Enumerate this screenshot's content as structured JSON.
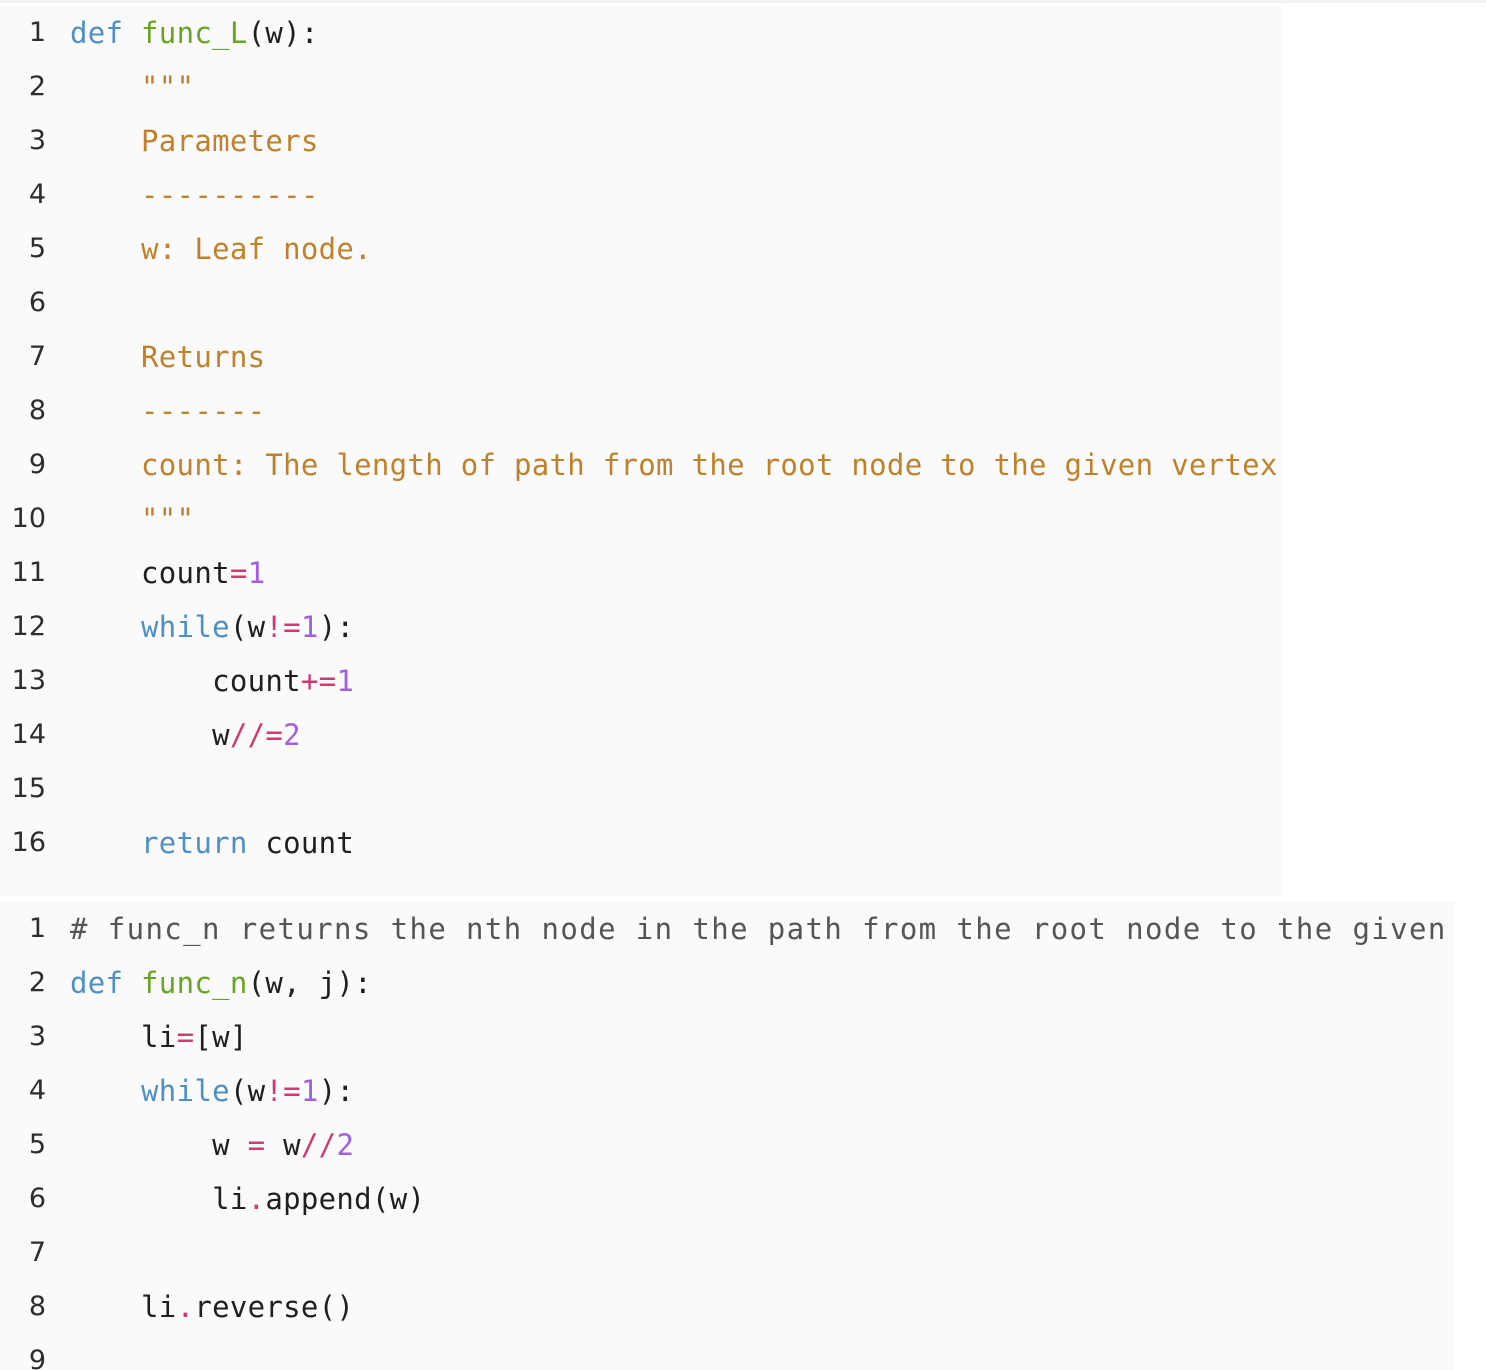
{
  "colors": {
    "keyword": "#4f8fc4",
    "function": "#6aa521",
    "docstring": "#c0812c",
    "operator": "#d13a70",
    "number": "#a45fe0",
    "plain": "#1f1f1f",
    "comment": "#555555",
    "punct": "#1f1f1f"
  },
  "blocks": [
    {
      "name": "code-block-func-L",
      "lines": [
        {
          "num": "1",
          "tokens": [
            {
              "t": "def",
              "c": "keyword"
            },
            {
              "t": " ",
              "c": "plain"
            },
            {
              "t": "func_L",
              "c": "function"
            },
            {
              "t": "(w):",
              "c": "punct"
            }
          ]
        },
        {
          "num": "2",
          "tokens": [
            {
              "t": "    \"\"\"",
              "c": "docstring"
            }
          ]
        },
        {
          "num": "3",
          "tokens": [
            {
              "t": "    Parameters",
              "c": "docstring"
            }
          ]
        },
        {
          "num": "4",
          "tokens": [
            {
              "t": "    ----------",
              "c": "docstring"
            }
          ]
        },
        {
          "num": "5",
          "tokens": [
            {
              "t": "    w: Leaf node.",
              "c": "docstring"
            }
          ]
        },
        {
          "num": "6",
          "tokens": []
        },
        {
          "num": "7",
          "tokens": [
            {
              "t": "    Returns",
              "c": "docstring"
            }
          ]
        },
        {
          "num": "8",
          "tokens": [
            {
              "t": "    -------",
              "c": "docstring"
            }
          ]
        },
        {
          "num": "9",
          "tokens": [
            {
              "t": "    count: The length of path from the root node to the given vertex.",
              "c": "docstring"
            }
          ]
        },
        {
          "num": "10",
          "tokens": [
            {
              "t": "    \"\"\"",
              "c": "docstring"
            }
          ]
        },
        {
          "num": "11",
          "tokens": [
            {
              "t": "    count",
              "c": "plain"
            },
            {
              "t": "=",
              "c": "operator"
            },
            {
              "t": "1",
              "c": "number"
            }
          ]
        },
        {
          "num": "12",
          "tokens": [
            {
              "t": "    ",
              "c": "plain"
            },
            {
              "t": "while",
              "c": "keyword"
            },
            {
              "t": "(w",
              "c": "punct"
            },
            {
              "t": "!=",
              "c": "operator"
            },
            {
              "t": "1",
              "c": "number"
            },
            {
              "t": "):",
              "c": "punct"
            }
          ]
        },
        {
          "num": "13",
          "tokens": [
            {
              "t": "        count",
              "c": "plain"
            },
            {
              "t": "+=",
              "c": "operator"
            },
            {
              "t": "1",
              "c": "number"
            }
          ]
        },
        {
          "num": "14",
          "tokens": [
            {
              "t": "        w",
              "c": "plain"
            },
            {
              "t": "//=",
              "c": "operator"
            },
            {
              "t": "2",
              "c": "number"
            }
          ]
        },
        {
          "num": "15",
          "tokens": []
        },
        {
          "num": "16",
          "tokens": [
            {
              "t": "    ",
              "c": "plain"
            },
            {
              "t": "return",
              "c": "keyword"
            },
            {
              "t": " count",
              "c": "plain"
            }
          ]
        }
      ]
    },
    {
      "name": "code-block-func-n",
      "lines": [
        {
          "num": "1",
          "tokens": [
            {
              "t": "# func_n returns the nth node in the path from the root node to the given vertex",
              "c": "comment"
            }
          ]
        },
        {
          "num": "2",
          "tokens": [
            {
              "t": "def",
              "c": "keyword"
            },
            {
              "t": " ",
              "c": "plain"
            },
            {
              "t": "func_n",
              "c": "function"
            },
            {
              "t": "(w, j):",
              "c": "punct"
            }
          ]
        },
        {
          "num": "3",
          "tokens": [
            {
              "t": "    li",
              "c": "plain"
            },
            {
              "t": "=",
              "c": "operator"
            },
            {
              "t": "[w]",
              "c": "punct"
            }
          ]
        },
        {
          "num": "4",
          "tokens": [
            {
              "t": "    ",
              "c": "plain"
            },
            {
              "t": "while",
              "c": "keyword"
            },
            {
              "t": "(w",
              "c": "punct"
            },
            {
              "t": "!=",
              "c": "operator"
            },
            {
              "t": "1",
              "c": "number"
            },
            {
              "t": "):",
              "c": "punct"
            }
          ]
        },
        {
          "num": "5",
          "tokens": [
            {
              "t": "        w ",
              "c": "plain"
            },
            {
              "t": "=",
              "c": "operator"
            },
            {
              "t": " w",
              "c": "plain"
            },
            {
              "t": "//",
              "c": "operator"
            },
            {
              "t": "2",
              "c": "number"
            }
          ]
        },
        {
          "num": "6",
          "tokens": [
            {
              "t": "        li",
              "c": "plain"
            },
            {
              "t": ".",
              "c": "operator"
            },
            {
              "t": "append(w)",
              "c": "plain"
            }
          ]
        },
        {
          "num": "7",
          "tokens": []
        },
        {
          "num": "8",
          "tokens": [
            {
              "t": "    li",
              "c": "plain"
            },
            {
              "t": ".",
              "c": "operator"
            },
            {
              "t": "reverse()",
              "c": "plain"
            }
          ]
        },
        {
          "num": "9",
          "tokens": []
        }
      ]
    }
  ]
}
